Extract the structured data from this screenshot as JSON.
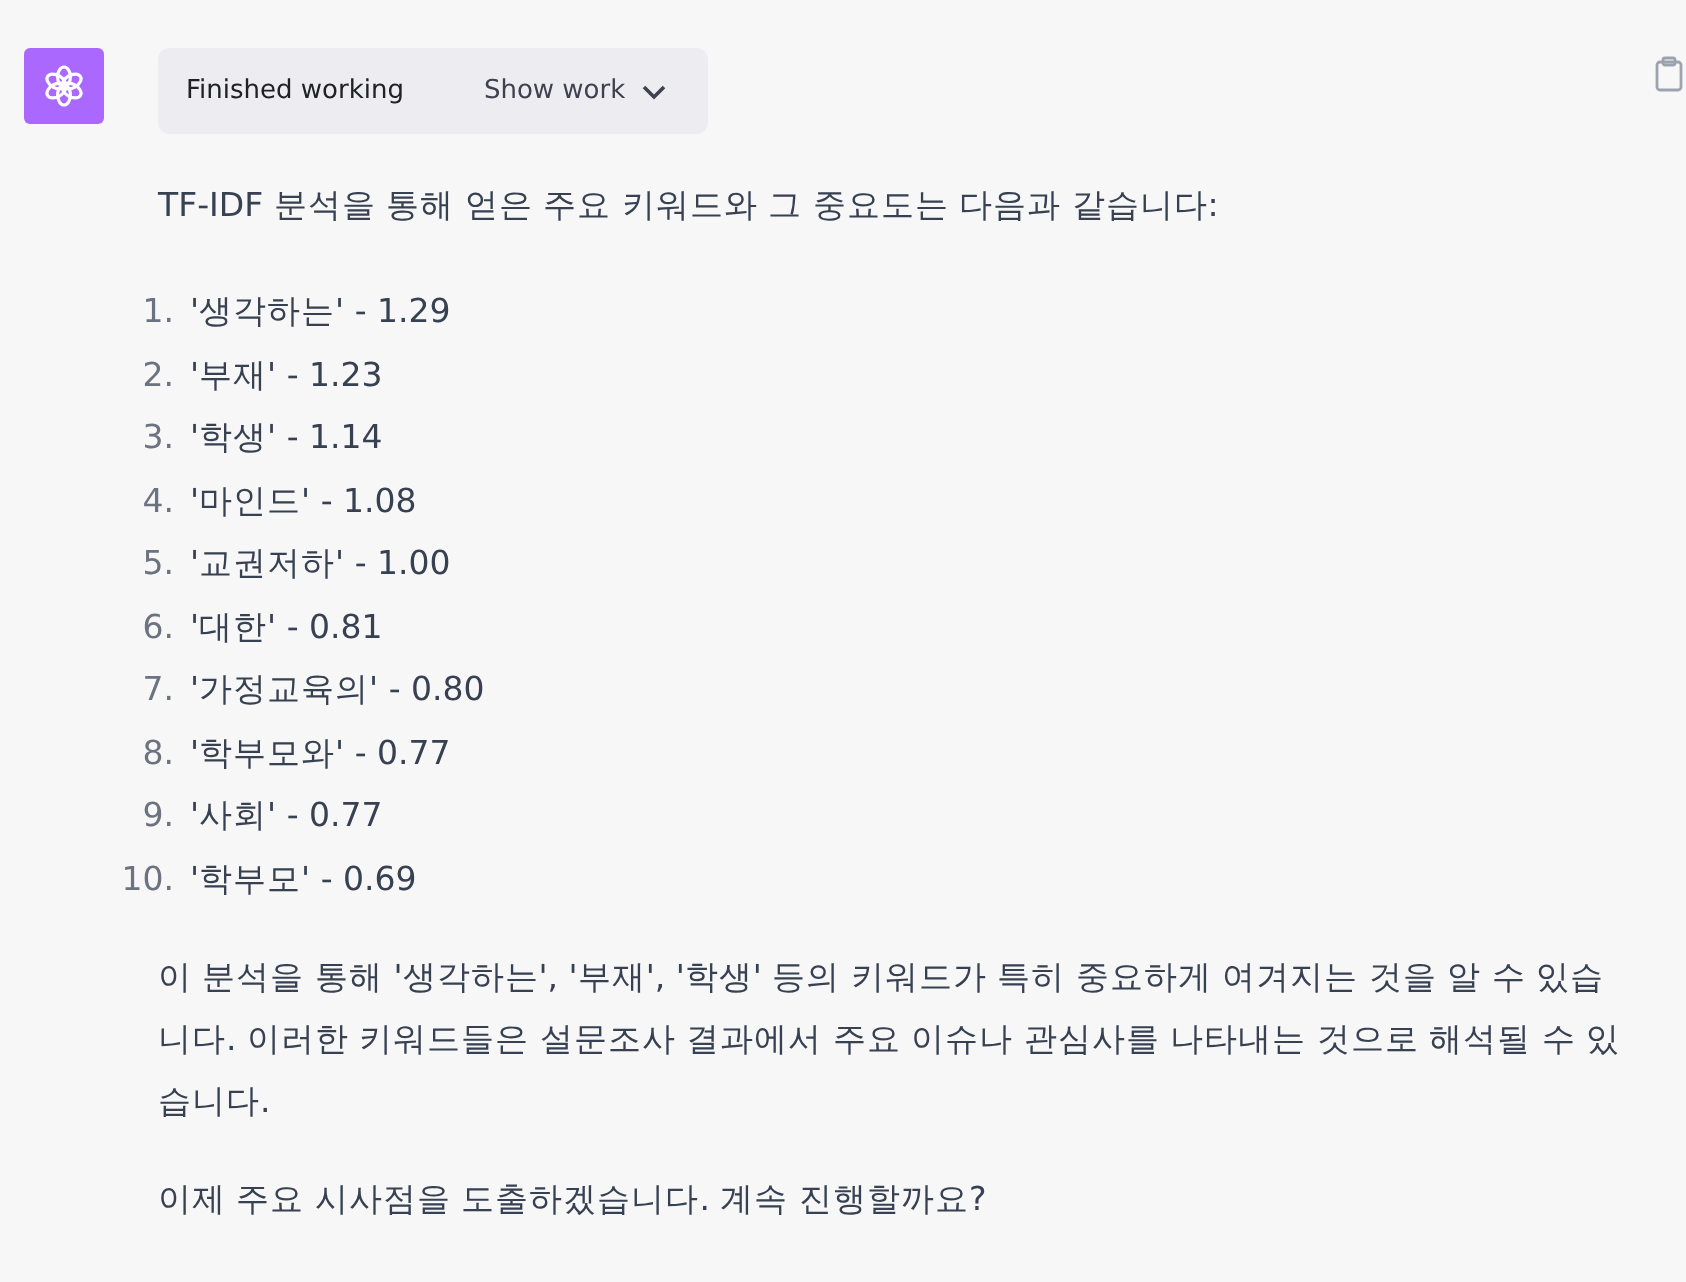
{
  "status": {
    "label": "Finished working",
    "toggle": "Show work"
  },
  "intro": "TF-IDF 분석을 통해 얻은 주요 키워드와 그 중요도는 다음과 같습니다:",
  "keywords": [
    {
      "number": "1.",
      "text": "'생각하는' - 1.29"
    },
    {
      "number": "2.",
      "text": "'부재' - 1.23"
    },
    {
      "number": "3.",
      "text": "'학생' - 1.14"
    },
    {
      "number": "4.",
      "text": "'마인드' - 1.08"
    },
    {
      "number": "5.",
      "text": "'교권저하' - 1.00"
    },
    {
      "number": "6.",
      "text": "'대한' - 0.81"
    },
    {
      "number": "7.",
      "text": "'가정교육의' - 0.80"
    },
    {
      "number": "8.",
      "text": "'학부모와' - 0.77"
    },
    {
      "number": "9.",
      "text": "'사회' - 0.77"
    },
    {
      "number": "10.",
      "text": "'학부모' - 0.69"
    }
  ],
  "paragraphs": [
    "이 분석을 통해 '생각하는', '부재', '학생' 등의 키워드가 특히 중요하게 여겨지는 것을 알 수 있습니다. 이러한 키워드들은 설문조사 결과에서 주요 이슈나 관심사를 나타내는 것으로 해석될 수 있습니다.",
    "이제 주요 시사점을 도출하겠습니다. 계속 진행할까요?"
  ]
}
